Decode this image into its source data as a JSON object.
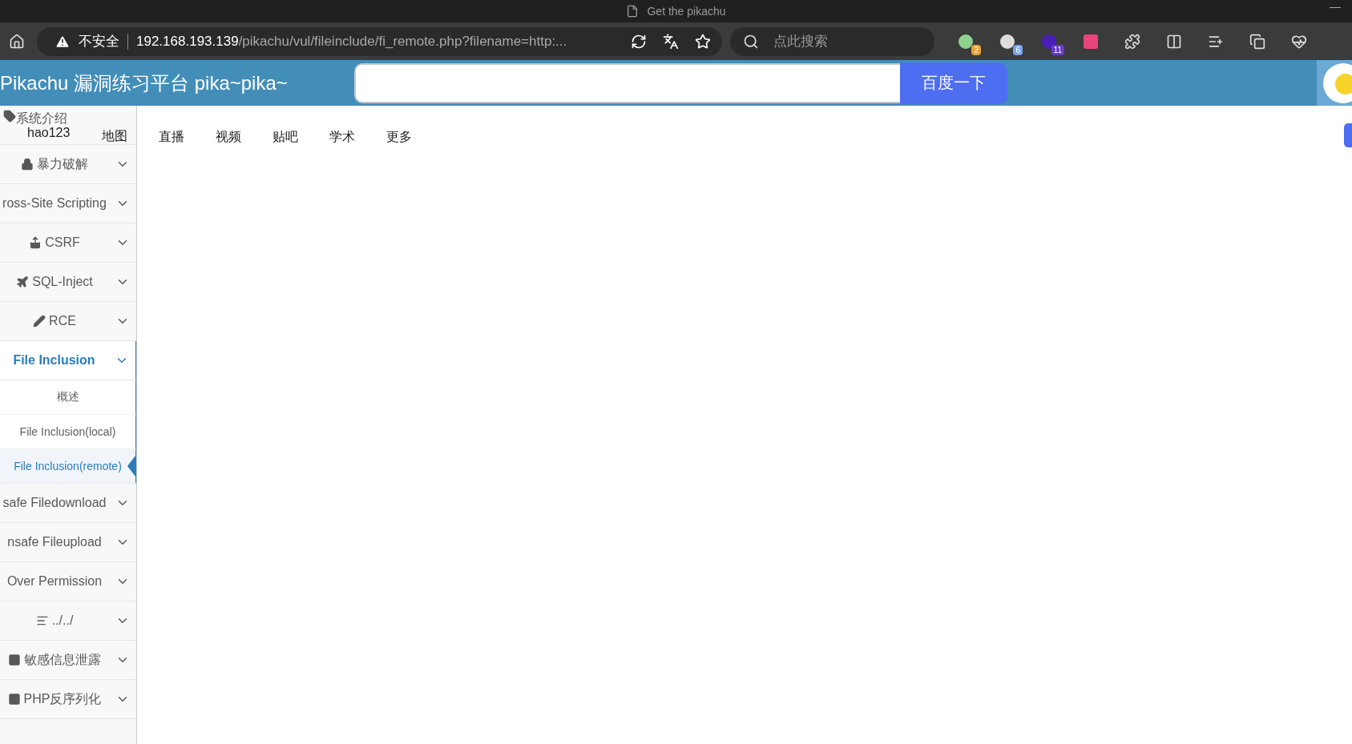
{
  "window": {
    "title": "Get the pikachu",
    "minimize": "—"
  },
  "browser": {
    "security": "不安全",
    "url_host": "192.168.193.139",
    "url_path": "/pikachu/vul/fileinclude/fi_remote.php?filename=http:...",
    "search": {
      "placeholder": "点此搜索"
    },
    "extension_badges": [
      "2",
      "6",
      "11"
    ]
  },
  "header": {
    "title": "Pikachu 漏洞练习平台 pika~pika~",
    "search_button": "百度一下"
  },
  "overlay_links": [
    "hao123",
    "地图"
  ],
  "nav": [
    "直播",
    "视频",
    "贴吧",
    "学术",
    "更多"
  ],
  "sidebar": {
    "items": [
      {
        "label": "系统介绍",
        "selected": false
      },
      {
        "label": "暴力破解",
        "selected": false
      },
      {
        "label": "ross-Site Scripting",
        "selected": false
      },
      {
        "label": "CSRF",
        "selected": false
      },
      {
        "label": "SQL-Inject",
        "selected": false
      },
      {
        "label": "RCE",
        "selected": false
      },
      {
        "label": "File Inclusion",
        "expanded": true,
        "selected": true,
        "children": [
          {
            "label": "概述",
            "selected": false
          },
          {
            "label": "File Inclusion(local)",
            "selected": false
          },
          {
            "label": "File Inclusion(remote)",
            "selected": true
          }
        ]
      },
      {
        "label": "safe Filedownload",
        "selected": false
      },
      {
        "label": "nsafe Fileupload",
        "selected": false
      },
      {
        "label": "Over Permission",
        "selected": false
      },
      {
        "label": "../../",
        "selected": false
      },
      {
        "label": "敏感信息泄露",
        "selected": false
      },
      {
        "label": "PHP反序列化",
        "selected": false
      }
    ]
  }
}
